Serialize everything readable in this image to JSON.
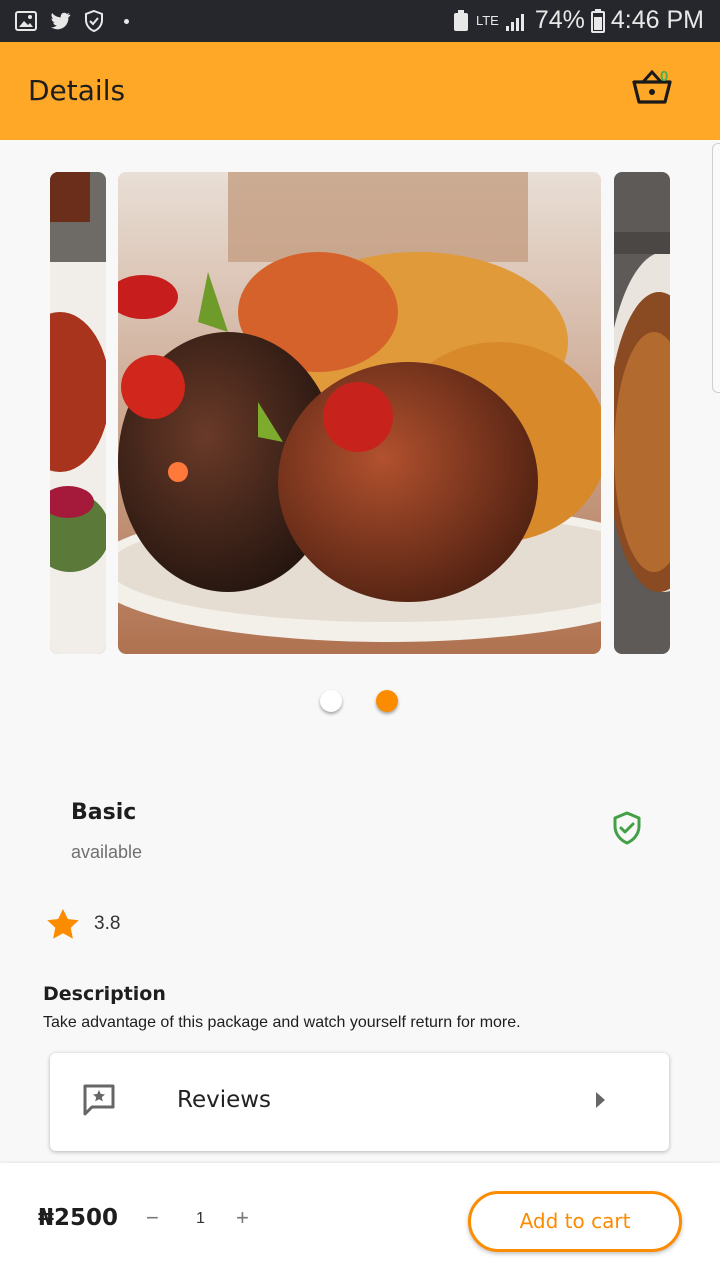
{
  "status_bar": {
    "network": "LTE",
    "battery": "74%",
    "time": "4:46 PM"
  },
  "app_bar": {
    "title": "Details",
    "cart_count": "0"
  },
  "carousel": {
    "slide_count": 2,
    "active_index": 1
  },
  "product": {
    "name": "Basic",
    "status": "available",
    "rating": "3.8",
    "description_title": "Description",
    "description": "Take advantage of this package and watch yourself return for more."
  },
  "reviews": {
    "label": "Reviews"
  },
  "bottom_bar": {
    "price": "₦2500",
    "minus": "−",
    "quantity": "1",
    "plus": "+",
    "add_to_cart": "Add to cart"
  },
  "colors": {
    "appbar": "#ffa726",
    "accent": "#fb8c00",
    "badge": "#4caf50",
    "verified": "#43a047"
  },
  "icons": [
    "gallery-icon",
    "twitter-icon",
    "shield-status-icon",
    "basket-icon",
    "verified-shield-icon",
    "star-icon",
    "reviews-icon",
    "chevron-right-icon"
  ]
}
